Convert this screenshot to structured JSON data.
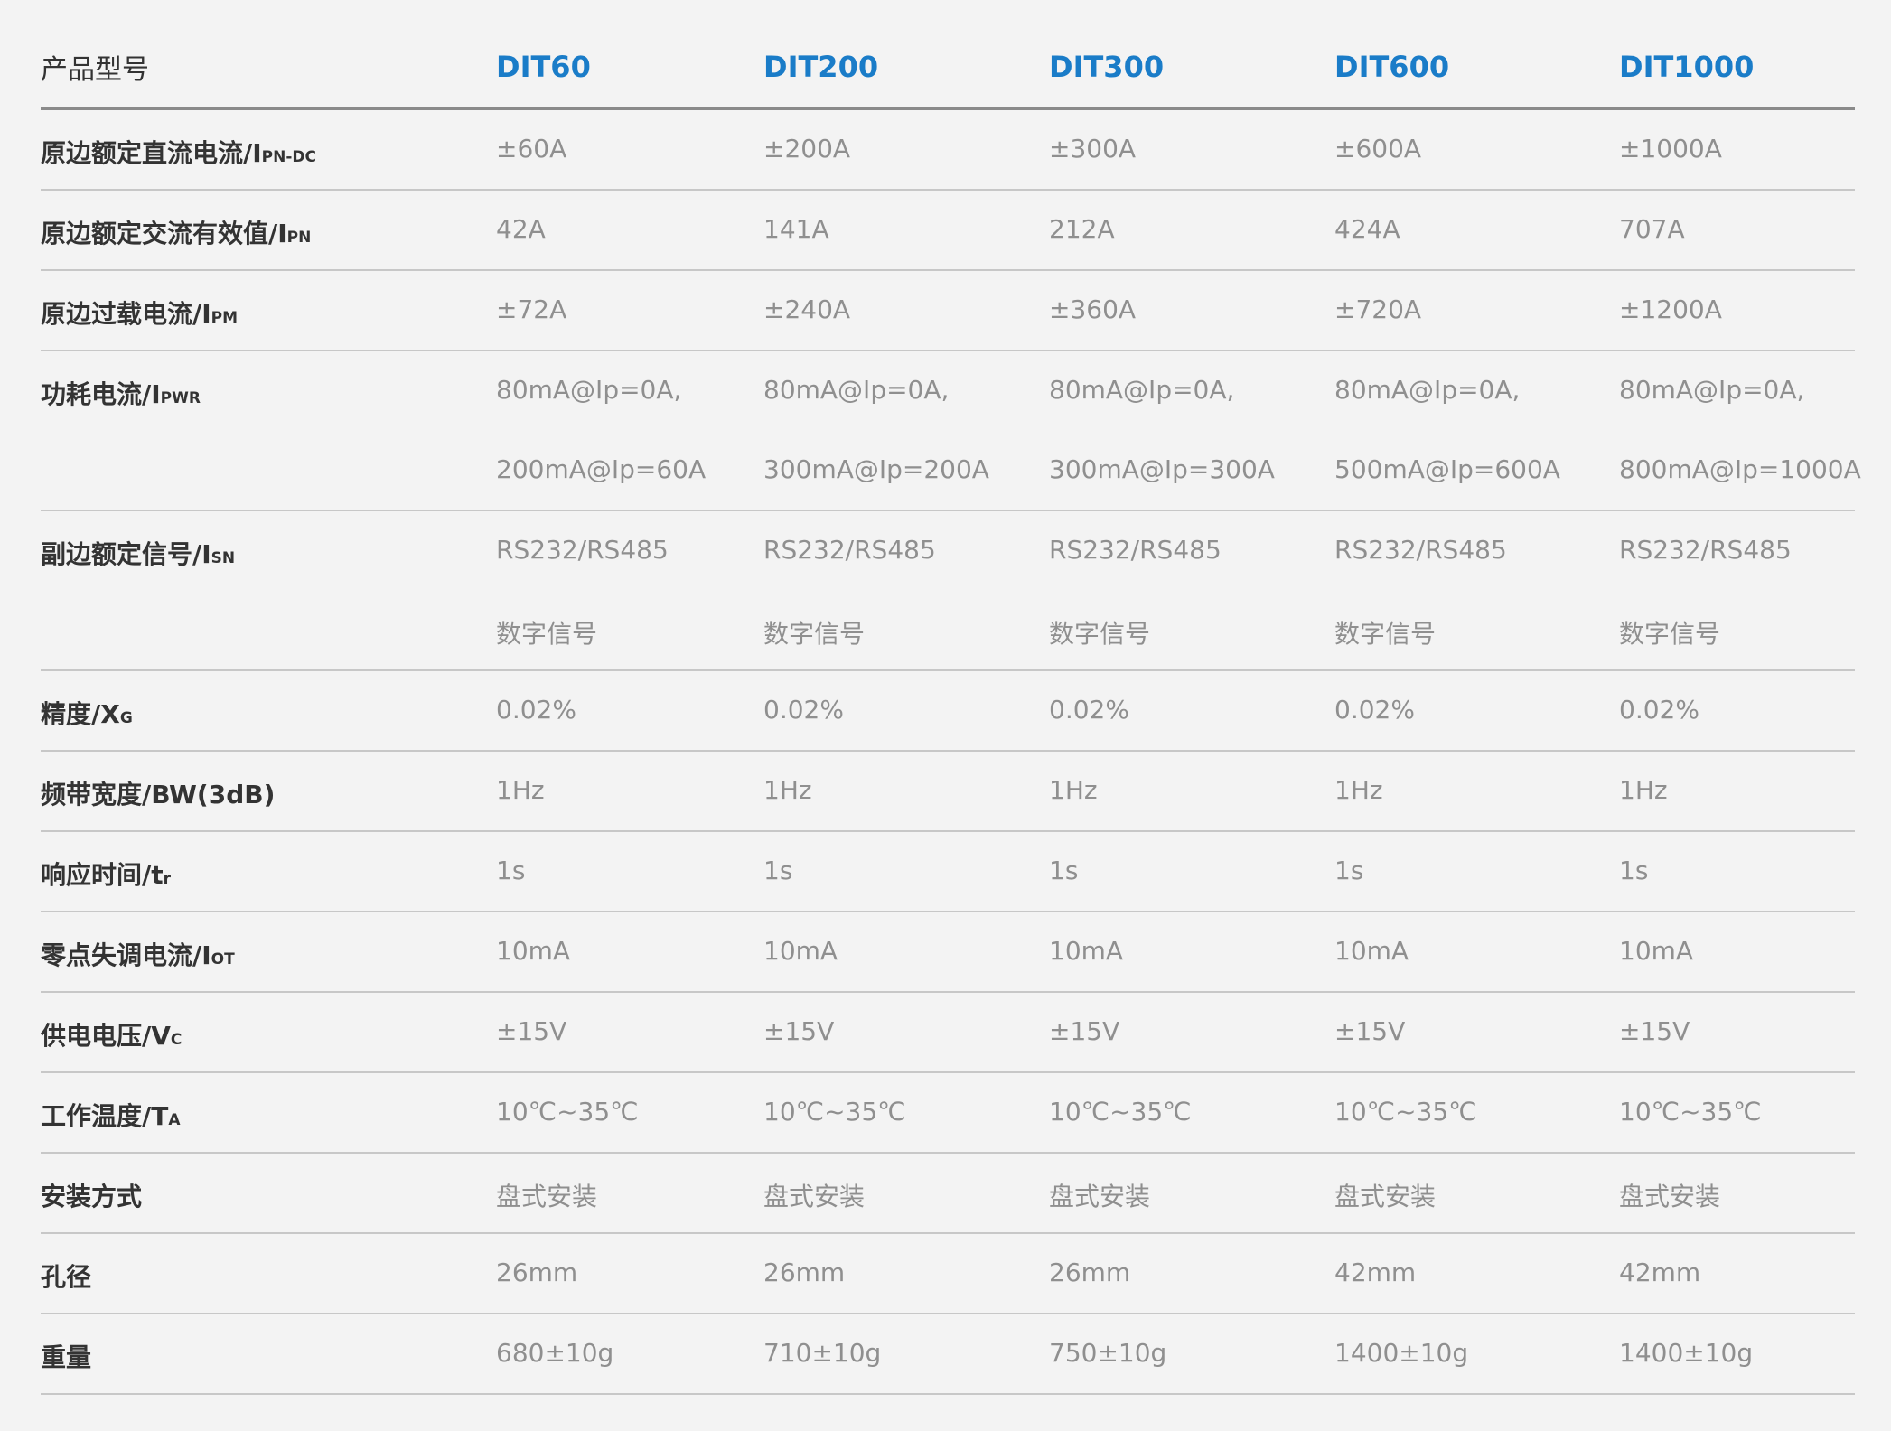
{
  "header": {
    "label": "产品型号",
    "models": [
      "DIT60",
      "DIT200",
      "DIT300",
      "DIT600",
      "DIT1000"
    ]
  },
  "rows": [
    {
      "label": "原边额定直流电流/I",
      "sub": "PN-DC",
      "values": [
        "±60A",
        "±200A",
        "±300A",
        "±600A",
        "±1000A"
      ]
    },
    {
      "label": "原边额定交流有效值/I",
      "sub": "PN",
      "values": [
        "42A",
        "141A",
        "212A",
        "424A",
        "707A"
      ]
    },
    {
      "label": "原边过载电流/I",
      "sub": "PM",
      "values": [
        "±72A",
        "±240A",
        "±360A",
        "±720A",
        "±1200A"
      ]
    },
    {
      "label": "功耗电流/I",
      "sub": "PWR",
      "values": [
        "80mA@Ip=0A,",
        "80mA@Ip=0A,",
        "80mA@Ip=0A,",
        "80mA@Ip=0A,",
        "80mA@Ip=0A,"
      ],
      "values2": [
        "200mA@Ip=60A",
        "300mA@Ip=200A",
        "300mA@Ip=300A",
        "500mA@Ip=600A",
        "800mA@Ip=1000A"
      ]
    },
    {
      "label": "副边额定信号/I",
      "sub": "SN",
      "values": [
        "RS232/RS485",
        "RS232/RS485",
        "RS232/RS485",
        "RS232/RS485",
        "RS232/RS485"
      ],
      "values2": [
        "数字信号",
        "数字信号",
        "数字信号",
        "数字信号",
        "数字信号"
      ]
    },
    {
      "label": "精度/X",
      "sub": "G",
      "values": [
        "0.02%",
        "0.02%",
        "0.02%",
        "0.02%",
        "0.02%"
      ]
    },
    {
      "label": "频带宽度/BW(3dB)",
      "sub": "",
      "values": [
        "1Hz",
        "1Hz",
        "1Hz",
        "1Hz",
        "1Hz"
      ]
    },
    {
      "label": "响应时间/t",
      "sub": "r",
      "values": [
        "1s",
        "1s",
        "1s",
        "1s",
        "1s"
      ]
    },
    {
      "label": "零点失调电流/I",
      "sub": "OT",
      "values": [
        "10mA",
        "10mA",
        "10mA",
        "10mA",
        "10mA"
      ]
    },
    {
      "label": "供电电压/V",
      "sub": "C",
      "values": [
        "±15V",
        "±15V",
        "±15V",
        "±15V",
        "±15V"
      ]
    },
    {
      "label": "工作温度/T",
      "sub": "A",
      "values": [
        "10℃~35℃",
        "10℃~35℃",
        "10℃~35℃",
        "10℃~35℃",
        "10℃~35℃"
      ]
    },
    {
      "label": "安装方式",
      "sub": "",
      "values": [
        "盘式安装",
        "盘式安装",
        "盘式安装",
        "盘式安装",
        "盘式安装"
      ]
    },
    {
      "label": "孔径",
      "sub": "",
      "values": [
        "26mm",
        "26mm",
        "26mm",
        "42mm",
        "42mm"
      ]
    },
    {
      "label": "重量",
      "sub": "",
      "values": [
        "680±10g",
        "710±10g",
        "750±10g",
        "1400±10g",
        "1400±10g"
      ]
    }
  ]
}
